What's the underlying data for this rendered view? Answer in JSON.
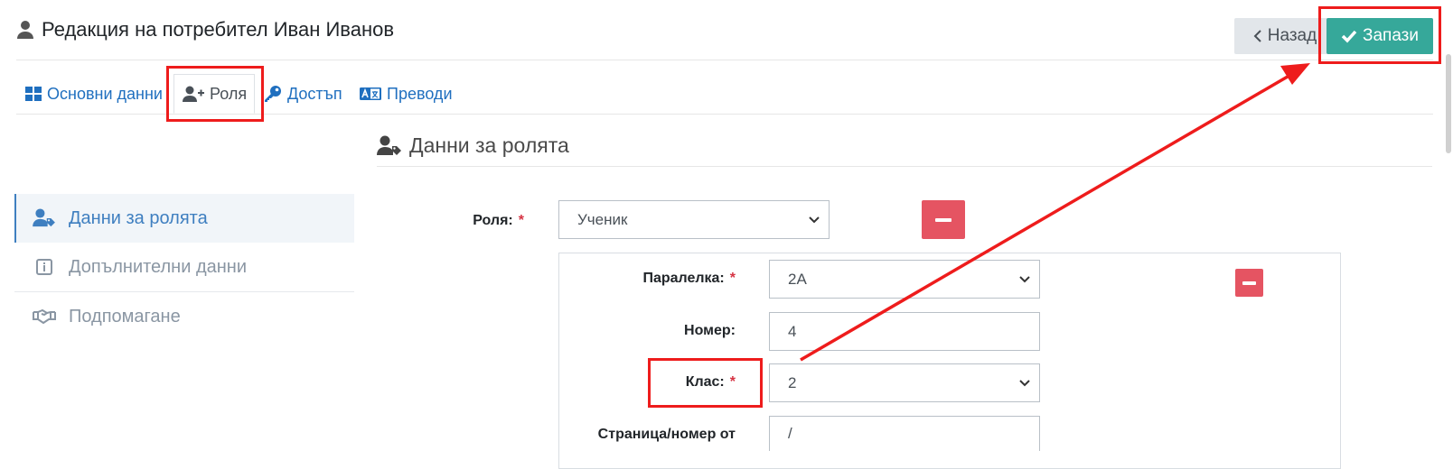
{
  "header": {
    "title": "Редакция на потребител Иван Иванов",
    "back_label": "Назад",
    "save_label": "Запази"
  },
  "tabs": [
    {
      "label": "Основни данни",
      "icon": "grid-icon"
    },
    {
      "label": "Роля",
      "icon": "user-plus-icon",
      "active": true
    },
    {
      "label": "Достъп",
      "icon": "key-icon"
    },
    {
      "label": "Преводи",
      "icon": "translate-icon"
    }
  ],
  "section": {
    "title": "Данни за ролята"
  },
  "sidebar": {
    "items": [
      {
        "label": "Данни за ролята",
        "icon": "user-tag-icon",
        "active": true
      },
      {
        "label": "Допълнителни данни",
        "icon": "info-icon"
      },
      {
        "label": "Подпомагане",
        "icon": "handshake-icon"
      }
    ]
  },
  "form": {
    "role": {
      "label": "Роля:",
      "value": "Ученик"
    },
    "class_section": {
      "label": "Паралелка:",
      "value": "2A"
    },
    "number": {
      "label": "Номер:",
      "value": "4"
    },
    "grade": {
      "label": "Клас:",
      "value": "2"
    },
    "page_number": {
      "label": "Страница/номер от",
      "value": "/"
    },
    "required_mark": "*"
  },
  "colors": {
    "accent": "#36a89a",
    "link": "#1f6fbf",
    "danger": "#e55462",
    "annotation": "#ee1c1c"
  }
}
